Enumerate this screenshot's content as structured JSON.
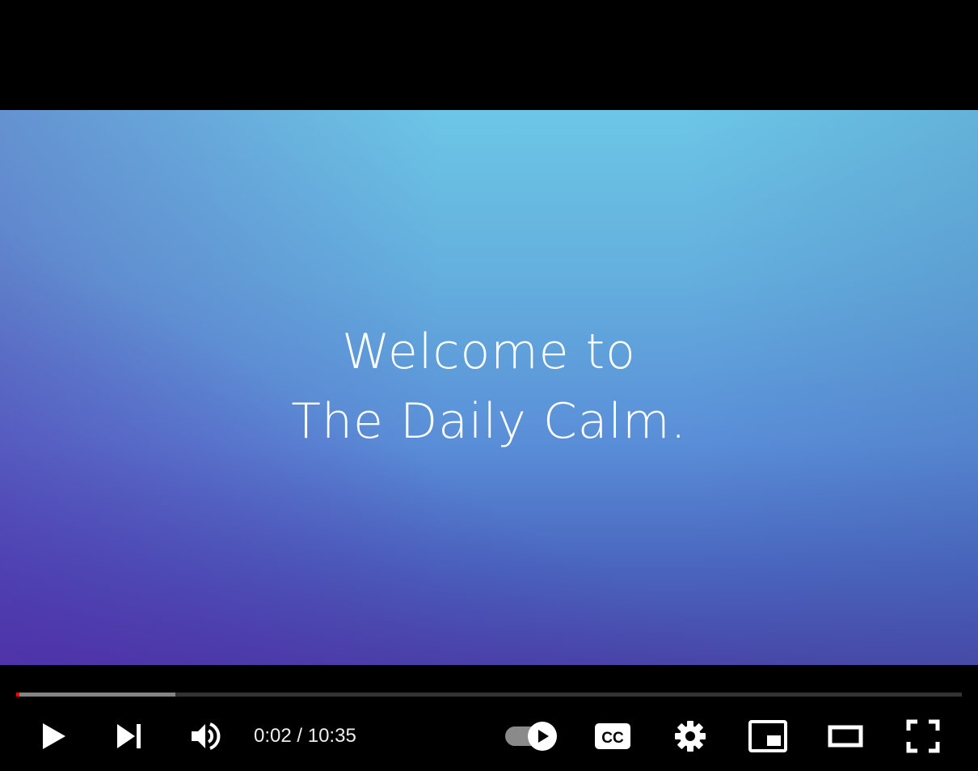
{
  "video": {
    "title_line1": "Welcome to",
    "title_line2": "The Daily Calm.",
    "colors": {
      "letterbox": "#000000",
      "gradient_top": "#6cc6e6",
      "gradient_bottom": "#4846a8",
      "accent_purple": "#5632aa"
    }
  },
  "controls": {
    "time": {
      "current": "0:02",
      "separator": " / ",
      "duration": "10:35"
    },
    "progress": {
      "played_fraction": 0.003,
      "buffered_fraction": 0.168,
      "played_color": "#ff0000"
    },
    "icons": {
      "play": "play-icon",
      "next": "next-icon",
      "volume": "volume-icon",
      "autoplay": "autoplay-toggle-icon",
      "cc": "cc-icon",
      "settings": "gear-icon",
      "miniplayer": "miniplayer-icon",
      "theater": "theater-mode-icon",
      "fullscreen": "fullscreen-icon"
    },
    "cc_label": "CC",
    "autoplay_on": true
  }
}
